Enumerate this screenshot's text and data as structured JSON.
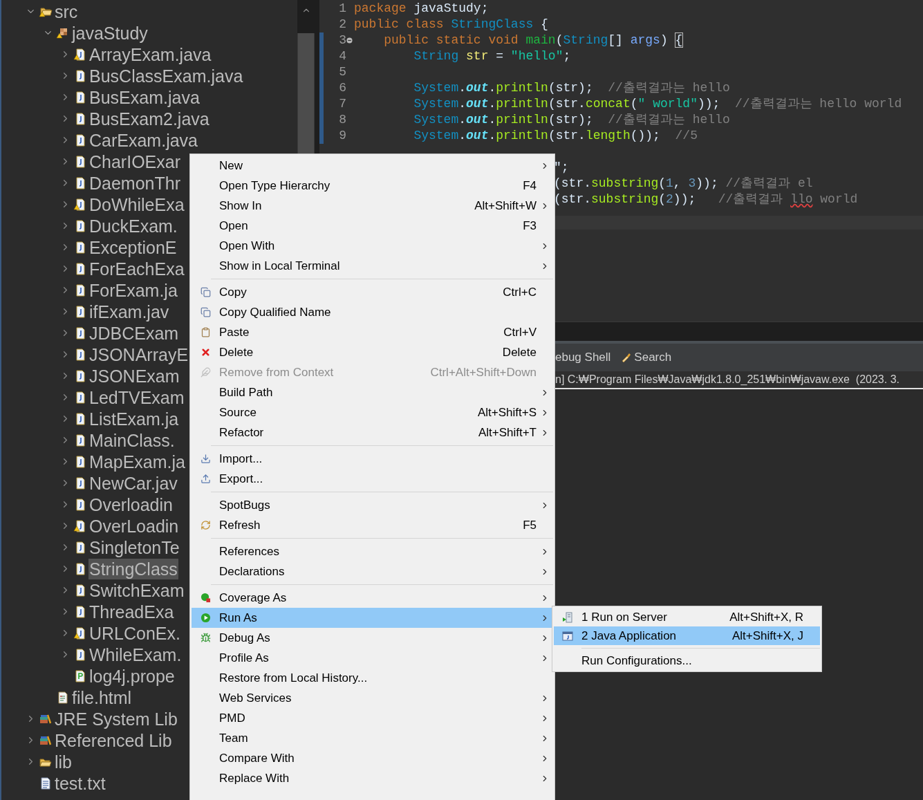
{
  "project_tree": [
    {
      "label": "src",
      "kind": "source-folder",
      "expanded": true,
      "warning": true,
      "selected": false,
      "children": [
        {
          "label": "javaStudy",
          "kind": "package",
          "expanded": true,
          "warning": true,
          "selected": false,
          "children": [
            {
              "label": "ArrayExam.java",
              "kind": "java",
              "expanded": false,
              "warning": true,
              "selected": false
            },
            {
              "label": "BusClassExam.java",
              "kind": "java",
              "expanded": false,
              "warning": false,
              "selected": false
            },
            {
              "label": "BusExam.java",
              "kind": "java",
              "expanded": false,
              "warning": false,
              "selected": false
            },
            {
              "label": "BusExam2.java",
              "kind": "java",
              "expanded": false,
              "warning": false,
              "selected": false
            },
            {
              "label": "CarExam.java",
              "kind": "java",
              "expanded": false,
              "warning": false,
              "selected": false
            },
            {
              "label": "CharIOExar",
              "kind": "java",
              "expanded": false,
              "warning": false,
              "selected": false
            },
            {
              "label": "DaemonThr",
              "kind": "java",
              "expanded": false,
              "warning": false,
              "selected": false
            },
            {
              "label": "DoWhileExa",
              "kind": "java",
              "expanded": false,
              "warning": true,
              "selected": false
            },
            {
              "label": "DuckExam.",
              "kind": "java",
              "expanded": false,
              "warning": false,
              "selected": false
            },
            {
              "label": "ExceptionE",
              "kind": "java",
              "expanded": false,
              "warning": false,
              "selected": false
            },
            {
              "label": "ForEachExa",
              "kind": "java",
              "expanded": false,
              "warning": false,
              "selected": false
            },
            {
              "label": "ForExam.ja",
              "kind": "java",
              "expanded": false,
              "warning": false,
              "selected": false
            },
            {
              "label": "ifExam.jav",
              "kind": "java",
              "expanded": false,
              "warning": false,
              "selected": false
            },
            {
              "label": "JDBCExam",
              "kind": "java",
              "expanded": false,
              "warning": false,
              "selected": false
            },
            {
              "label": "JSONArrayE",
              "kind": "java",
              "expanded": false,
              "warning": false,
              "selected": false
            },
            {
              "label": "JSONExam",
              "kind": "java",
              "expanded": false,
              "warning": false,
              "selected": false
            },
            {
              "label": "LedTVExam",
              "kind": "java",
              "expanded": false,
              "warning": false,
              "selected": false
            },
            {
              "label": "ListExam.ja",
              "kind": "java",
              "expanded": false,
              "warning": false,
              "selected": false
            },
            {
              "label": "MainClass.",
              "kind": "java",
              "expanded": false,
              "warning": false,
              "selected": false
            },
            {
              "label": "MapExam.ja",
              "kind": "java",
              "expanded": false,
              "warning": false,
              "selected": false
            },
            {
              "label": "NewCar.jav",
              "kind": "java",
              "expanded": false,
              "warning": false,
              "selected": false
            },
            {
              "label": "Overloadin",
              "kind": "java",
              "expanded": false,
              "warning": false,
              "selected": false
            },
            {
              "label": "OverLoadin",
              "kind": "java",
              "expanded": false,
              "warning": true,
              "selected": false
            },
            {
              "label": "SingletonTe",
              "kind": "java",
              "expanded": false,
              "warning": false,
              "selected": false
            },
            {
              "label": "StringClass",
              "kind": "java",
              "expanded": false,
              "warning": false,
              "selected": true
            },
            {
              "label": "SwitchExam",
              "kind": "java",
              "expanded": false,
              "warning": false,
              "selected": false
            },
            {
              "label": "ThreadExa",
              "kind": "java",
              "expanded": false,
              "warning": false,
              "selected": false
            },
            {
              "label": "URLConEx.",
              "kind": "java",
              "expanded": false,
              "warning": true,
              "selected": false
            },
            {
              "label": "WhileExam.",
              "kind": "java",
              "expanded": false,
              "warning": false,
              "selected": false
            },
            {
              "label": "log4j.prope",
              "kind": "properties",
              "warning": false,
              "selected": false
            }
          ]
        },
        {
          "label": "file.html",
          "kind": "html",
          "warning": false,
          "selected": false
        }
      ]
    },
    {
      "label": "JRE System Lib",
      "kind": "library",
      "expanded": false,
      "warning": false,
      "selected": false
    },
    {
      "label": "Referenced Lib",
      "kind": "library",
      "expanded": false,
      "warning": false,
      "selected": false
    },
    {
      "label": "lib",
      "kind": "folder",
      "expanded": false,
      "warning": false,
      "selected": false
    },
    {
      "label": "test.txt",
      "kind": "text",
      "warning": false,
      "selected": false
    }
  ],
  "editor": {
    "lines": [
      {
        "number": "1",
        "changed": false,
        "fold": false,
        "tokens": [
          {
            "kind": "keyword",
            "text": "package"
          },
          {
            "kind": "plain",
            "text": " javaStudy;"
          }
        ]
      },
      {
        "number": "2",
        "changed": false,
        "fold": false,
        "tokens": [
          {
            "kind": "keyword",
            "text": "public class "
          },
          {
            "kind": "type",
            "text": "StringClass"
          },
          {
            "kind": "plain",
            "text": " {"
          }
        ]
      },
      {
        "number": "3",
        "changed": true,
        "fold": true,
        "tokens": [
          {
            "kind": "keyword",
            "text": "    public static void "
          },
          {
            "kind": "method",
            "text": "main"
          },
          {
            "kind": "plain",
            "text": "("
          },
          {
            "kind": "type",
            "text": "String"
          },
          {
            "kind": "plain",
            "text": "[] "
          },
          {
            "kind": "param",
            "text": "args"
          },
          {
            "kind": "plain",
            "text": ") "
          },
          {
            "kind": "bracket",
            "text": "{"
          }
        ]
      },
      {
        "number": "4",
        "changed": true,
        "fold": false,
        "tokens": [
          {
            "kind": "type",
            "text": "        String "
          },
          {
            "kind": "local",
            "text": "str"
          },
          {
            "kind": "plain",
            "text": " = "
          },
          {
            "kind": "string",
            "text": "\"hello\""
          },
          {
            "kind": "plain",
            "text": ";"
          }
        ]
      },
      {
        "number": "5",
        "changed": true,
        "fold": false
      },
      {
        "number": "6",
        "changed": true,
        "fold": false,
        "tokens": [
          {
            "kind": "type",
            "text": "        System"
          },
          {
            "kind": "plain",
            "text": "."
          },
          {
            "kind": "field",
            "text": "out"
          },
          {
            "kind": "plain",
            "text": "."
          },
          {
            "kind": "call",
            "text": "println"
          },
          {
            "kind": "plain",
            "text": "(str);  "
          },
          {
            "kind": "comment",
            "text": "//출력결과는 hello"
          }
        ]
      },
      {
        "number": "7",
        "changed": true,
        "fold": false,
        "tokens": [
          {
            "kind": "type",
            "text": "        System"
          },
          {
            "kind": "plain",
            "text": "."
          },
          {
            "kind": "field",
            "text": "out"
          },
          {
            "kind": "plain",
            "text": "."
          },
          {
            "kind": "call",
            "text": "println"
          },
          {
            "kind": "plain",
            "text": "(str."
          },
          {
            "kind": "call",
            "text": "concat"
          },
          {
            "kind": "plain",
            "text": "("
          },
          {
            "kind": "string",
            "text": "\" world\""
          },
          {
            "kind": "plain",
            "text": "));  "
          },
          {
            "kind": "comment",
            "text": "//출력결과는 hello world"
          }
        ]
      },
      {
        "number": "8",
        "changed": true,
        "fold": false,
        "tokens": [
          {
            "kind": "type",
            "text": "        System"
          },
          {
            "kind": "plain",
            "text": "."
          },
          {
            "kind": "field",
            "text": "out"
          },
          {
            "kind": "plain",
            "text": "."
          },
          {
            "kind": "call",
            "text": "println"
          },
          {
            "kind": "plain",
            "text": "(str);  "
          },
          {
            "kind": "comment",
            "text": "//출력결과는 hello"
          }
        ]
      },
      {
        "number": "9",
        "changed": true,
        "fold": false,
        "tokens": [
          {
            "kind": "type",
            "text": "        System"
          },
          {
            "kind": "plain",
            "text": "."
          },
          {
            "kind": "field",
            "text": "out"
          },
          {
            "kind": "plain",
            "text": "."
          },
          {
            "kind": "call",
            "text": "println"
          },
          {
            "kind": "plain",
            "text": "(str."
          },
          {
            "kind": "call",
            "text": "length"
          },
          {
            "kind": "plain",
            "text": "());  "
          },
          {
            "kind": "comment",
            "text": "//5"
          }
        ]
      }
    ],
    "partial_lines": [
      {
        "tokens": [
          {
            "kind": "plain",
            "text": "\";"
          }
        ]
      },
      {
        "tokens": [
          {
            "kind": "plain",
            "text": "(str."
          },
          {
            "kind": "call",
            "text": "substring"
          },
          {
            "kind": "plain",
            "text": "("
          },
          {
            "kind": "number",
            "text": "1"
          },
          {
            "kind": "plain",
            "text": ", "
          },
          {
            "kind": "number",
            "text": "3"
          },
          {
            "kind": "plain",
            "text": ")); "
          },
          {
            "kind": "comment",
            "text": "//출력결과 el"
          }
        ]
      },
      {
        "tokens": [
          {
            "kind": "plain",
            "text": "(str."
          },
          {
            "kind": "call",
            "text": "substring"
          },
          {
            "kind": "plain",
            "text": "("
          },
          {
            "kind": "number",
            "text": "2"
          },
          {
            "kind": "plain",
            "text": "));   "
          },
          {
            "kind": "comment",
            "text": "//출력결과 "
          },
          {
            "kind": "flagged",
            "text": "llo"
          },
          {
            "kind": "comment",
            "text": " world"
          }
        ]
      }
    ]
  },
  "console": {
    "tabs": [
      {
        "label": "ebug Shell",
        "selected": false
      },
      {
        "label": "Search",
        "selected": false
      }
    ],
    "header": "n] C:₩Program Files₩Java₩jdk1.8.0_251₩bin₩javaw.exe  (2023. 3."
  },
  "context_menu": {
    "groups": [
      [
        {
          "label": "New",
          "submenu": true,
          "disabled": false,
          "selected": false
        },
        {
          "label": "Open Type Hierarchy",
          "shortcut": "F4",
          "submenu": false,
          "disabled": false,
          "selected": false
        },
        {
          "label": "Show In",
          "shortcut": "Alt+Shift+W",
          "submenu": true,
          "disabled": false,
          "selected": false
        },
        {
          "label": "Open",
          "shortcut": "F3",
          "submenu": false,
          "disabled": false,
          "selected": false
        },
        {
          "label": "Open With",
          "submenu": true,
          "disabled": false,
          "selected": false
        },
        {
          "label": "Show in Local Terminal",
          "submenu": true,
          "disabled": false,
          "selected": false
        }
      ],
      [
        {
          "label": "Copy",
          "shortcut": "Ctrl+C",
          "submenu": false,
          "disabled": false,
          "selected": false
        },
        {
          "label": "Copy Qualified Name",
          "submenu": false,
          "disabled": false,
          "selected": false
        },
        {
          "label": "Paste",
          "shortcut": "Ctrl+V",
          "submenu": false,
          "disabled": false,
          "selected": false
        },
        {
          "label": "Delete",
          "shortcut": "Delete",
          "submenu": false,
          "disabled": false,
          "selected": false
        },
        {
          "label": "Remove from Context",
          "shortcut": "Ctrl+Alt+Shift+Down",
          "submenu": false,
          "disabled": true,
          "selected": false
        },
        {
          "label": "Build Path",
          "submenu": true,
          "disabled": false,
          "selected": false
        },
        {
          "label": "Source",
          "shortcut": "Alt+Shift+S",
          "submenu": true,
          "disabled": false,
          "selected": false
        },
        {
          "label": "Refactor",
          "shortcut": "Alt+Shift+T",
          "submenu": true,
          "disabled": false,
          "selected": false
        }
      ],
      [
        {
          "label": "Import...",
          "submenu": false,
          "disabled": false,
          "selected": false
        },
        {
          "label": "Export...",
          "submenu": false,
          "disabled": false,
          "selected": false
        }
      ],
      [
        {
          "label": "SpotBugs",
          "submenu": true,
          "disabled": false,
          "selected": false
        },
        {
          "label": "Refresh",
          "shortcut": "F5",
          "submenu": false,
          "disabled": false,
          "selected": false
        }
      ],
      [
        {
          "label": "References",
          "submenu": true,
          "disabled": false,
          "selected": false
        },
        {
          "label": "Declarations",
          "submenu": true,
          "disabled": false,
          "selected": false
        }
      ],
      [
        {
          "label": "Coverage As",
          "submenu": true,
          "disabled": false,
          "selected": false
        },
        {
          "label": "Run As",
          "submenu": true,
          "disabled": false,
          "selected": true
        },
        {
          "label": "Debug As",
          "submenu": true,
          "disabled": false,
          "selected": false
        },
        {
          "label": "Profile As",
          "submenu": true,
          "disabled": false,
          "selected": false
        },
        {
          "label": "Restore from Local History...",
          "submenu": false,
          "disabled": false,
          "selected": false
        },
        {
          "label": "Web Services",
          "submenu": true,
          "disabled": false,
          "selected": false
        },
        {
          "label": "PMD",
          "submenu": true,
          "disabled": false,
          "selected": false
        },
        {
          "label": "Team",
          "submenu": true,
          "disabled": false,
          "selected": false
        },
        {
          "label": "Compare With",
          "submenu": true,
          "disabled": false,
          "selected": false
        },
        {
          "label": "Replace With",
          "submenu": true,
          "disabled": false,
          "selected": false
        }
      ]
    ]
  },
  "run_as_submenu": {
    "groups": [
      [
        {
          "label": "1 Run on Server",
          "shortcut": "Alt+Shift+X, R",
          "selected": false
        },
        {
          "label": "2 Java Application",
          "shortcut": "Alt+Shift+X, J",
          "selected": true
        }
      ],
      [
        {
          "label": "Run Configurations...",
          "selected": false
        }
      ]
    ]
  }
}
